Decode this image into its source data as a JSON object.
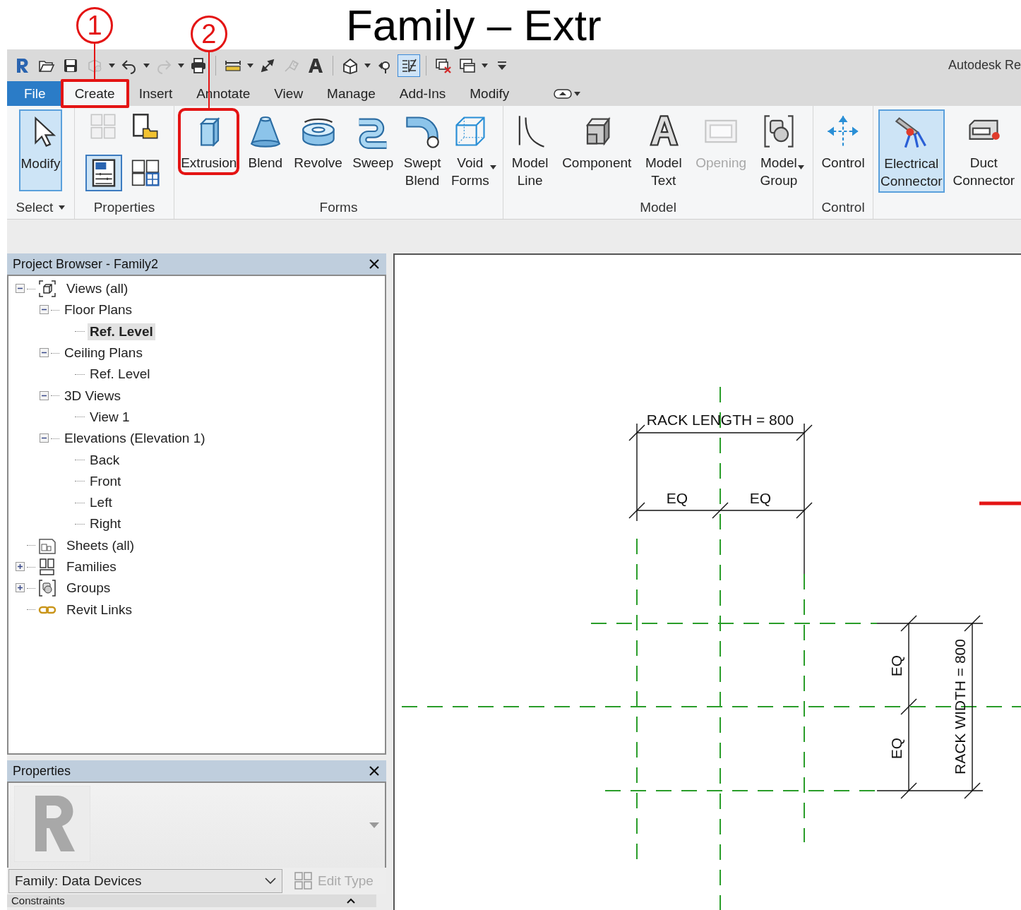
{
  "slide_title": "Family – Extr",
  "quick_access": {
    "groups": [
      {
        "tools": [
          {
            "kind": "logo",
            "disabled": false,
            "active": false
          },
          {
            "kind": "open",
            "disabled": false,
            "active": false
          },
          {
            "kind": "save",
            "disabled": false,
            "active": false
          },
          {
            "kind": "sync",
            "disabled": true,
            "active": false,
            "dropdown": true
          },
          {
            "kind": "undo",
            "disabled": false,
            "active": false,
            "dropdown": true
          },
          {
            "kind": "redo",
            "disabled": true,
            "active": false,
            "dropdown": true
          },
          {
            "kind": "print",
            "disabled": false,
            "active": false
          }
        ]
      },
      {
        "tools": [
          {
            "kind": "measure",
            "disabled": false,
            "active": false,
            "dropdown": true
          },
          {
            "kind": "aligned-dimension",
            "disabled": false,
            "active": false
          },
          {
            "kind": "tag",
            "disabled": true,
            "active": false
          },
          {
            "kind": "text",
            "disabled": false,
            "active": false
          }
        ]
      },
      {
        "tools": [
          {
            "kind": "default-3d",
            "disabled": false,
            "active": false,
            "dropdown": true
          },
          {
            "kind": "section",
            "disabled": false,
            "active": false
          },
          {
            "kind": "thin-lines",
            "disabled": false,
            "active": true
          }
        ]
      },
      {
        "tools": [
          {
            "kind": "close-windows",
            "disabled": false,
            "active": false
          },
          {
            "kind": "switch-windows",
            "disabled": false,
            "active": false,
            "dropdown": true
          },
          {
            "kind": "customize",
            "disabled": false,
            "active": false
          }
        ]
      }
    ],
    "product_title": "Autodesk Re"
  },
  "ribbon_tabs": [
    {
      "label": "File",
      "kind": "application",
      "selected": false
    },
    {
      "label": "Create",
      "kind": "tab",
      "selected": true,
      "callout": "1"
    },
    {
      "label": "Insert",
      "kind": "tab",
      "selected": false
    },
    {
      "label": "Annotate",
      "kind": "tab",
      "selected": false
    },
    {
      "label": "View",
      "kind": "tab",
      "selected": false
    },
    {
      "label": "Manage",
      "kind": "tab",
      "selected": false
    },
    {
      "label": "Add-Ins",
      "kind": "tab",
      "selected": false
    },
    {
      "label": "Modify",
      "kind": "tab",
      "selected": false
    }
  ],
  "ribbon_panels": [
    {
      "title": "Select",
      "title_dropdown": true,
      "items": [
        {
          "kind": "modify",
          "label": "Modify",
          "active": true,
          "disabled": false
        }
      ]
    },
    {
      "title": "Properties",
      "items": [
        {
          "kind": "family-types",
          "active": false,
          "disabled": true
        },
        {
          "kind": "family-category",
          "active": false,
          "disabled": false
        },
        {
          "kind": "properties",
          "active": true,
          "disabled": false
        },
        {
          "kind": "type-properties",
          "active": false,
          "disabled": false
        }
      ]
    },
    {
      "title": "Forms",
      "items": [
        {
          "kind": "extrusion",
          "label": "Extrusion",
          "active": false,
          "disabled": false,
          "callout": "2"
        },
        {
          "kind": "blend",
          "label": "Blend",
          "active": false,
          "disabled": false
        },
        {
          "kind": "revolve",
          "label": "Revolve",
          "active": false,
          "disabled": false
        },
        {
          "kind": "sweep",
          "label": "Sweep",
          "active": false,
          "disabled": false
        },
        {
          "kind": "swept-blend",
          "label": "Swept\nBlend",
          "active": false,
          "disabled": false
        },
        {
          "kind": "void-forms",
          "label": "Void\nForms",
          "active": false,
          "disabled": false,
          "dropdown": true
        }
      ]
    },
    {
      "title": "Model",
      "items": [
        {
          "kind": "model-line",
          "label": "Model\nLine",
          "active": false,
          "disabled": false
        },
        {
          "kind": "component",
          "label": "Component",
          "active": false,
          "disabled": false
        },
        {
          "kind": "model-text",
          "label": "Model\nText",
          "active": false,
          "disabled": false
        },
        {
          "kind": "opening",
          "label": "Opening",
          "active": false,
          "disabled": true
        },
        {
          "kind": "model-group",
          "label": "Model\nGroup",
          "active": false,
          "disabled": false,
          "dropdown": true
        }
      ]
    },
    {
      "title": "Control",
      "items": [
        {
          "kind": "control",
          "label": "Control",
          "active": false,
          "disabled": false
        }
      ]
    },
    {
      "items": [
        {
          "kind": "electrical-connector",
          "label": "Electrical\nConnector",
          "active": true,
          "disabled": false
        },
        {
          "kind": "duct-connector",
          "label": "Duct\nConnector",
          "active": false,
          "disabled": false
        }
      ]
    }
  ],
  "project_browser": {
    "title": "Project Browser - Family2",
    "tree": [
      {
        "label": "Views (all)",
        "kind": "views",
        "expanded": true,
        "selected": false,
        "children": [
          {
            "label": "Floor Plans",
            "expanded": true,
            "selected": false,
            "children": [
              {
                "label": "Ref. Level",
                "selected": true
              }
            ]
          },
          {
            "label": "Ceiling Plans",
            "expanded": true,
            "selected": false,
            "children": [
              {
                "label": "Ref. Level",
                "selected": false
              }
            ]
          },
          {
            "label": "3D Views",
            "expanded": true,
            "selected": false,
            "children": [
              {
                "label": "View 1",
                "selected": false
              }
            ]
          },
          {
            "label": "Elevations (Elevation 1)",
            "expanded": true,
            "selected": false,
            "children": [
              {
                "label": "Back",
                "selected": false
              },
              {
                "label": "Front",
                "selected": false
              },
              {
                "label": "Left",
                "selected": false
              },
              {
                "label": "Right",
                "selected": false
              }
            ]
          }
        ]
      },
      {
        "label": "Sheets (all)",
        "kind": "sheets",
        "selected": false
      },
      {
        "label": "Families",
        "kind": "families",
        "expanded": false,
        "selected": false
      },
      {
        "label": "Groups",
        "kind": "groups",
        "expanded": false,
        "selected": false
      },
      {
        "label": "Revit Links",
        "kind": "links",
        "selected": false
      }
    ]
  },
  "properties": {
    "title": "Properties",
    "type_selector": "Family: Data Devices",
    "edit_type": {
      "label": "Edit Type",
      "disabled": true
    },
    "category": "Constraints"
  },
  "canvas": {
    "length_dimension": "RACK LENGTH = 800",
    "length_eq": [
      "EQ",
      "EQ"
    ],
    "width_eq": [
      "EQ",
      "EQ"
    ],
    "width_dimension": "RACK WIDTH = 800"
  }
}
